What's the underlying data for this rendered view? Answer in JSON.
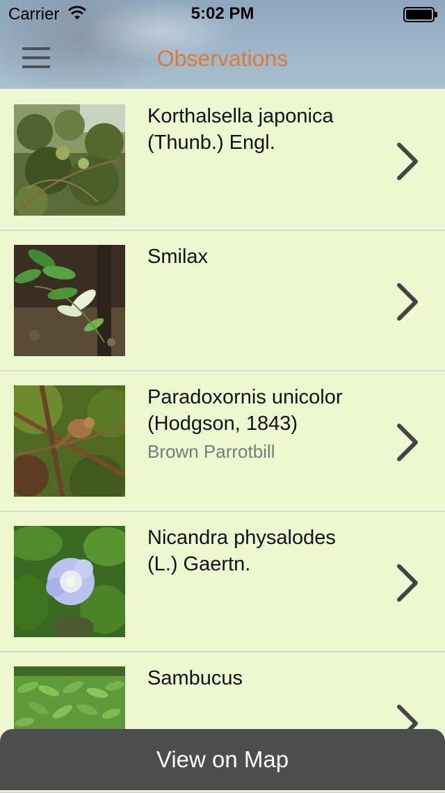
{
  "status_bar": {
    "carrier": "Carrier",
    "time": "5:02 PM"
  },
  "header": {
    "title": "Observations",
    "title_color": "#e07a2c"
  },
  "observations": [
    {
      "scientific_name": "Korthalsella japonica\n(Thunb.) Engl.",
      "common_name": "",
      "thumb": "mistletoe-shrub-photo"
    },
    {
      "scientific_name": "Smilax",
      "common_name": "",
      "thumb": "forest-vine-leaves-photo"
    },
    {
      "scientific_name": "Paradoxornis unicolor\n(Hodgson, 1843)",
      "common_name": "Brown Parrotbill",
      "thumb": "bird-on-branch-photo"
    },
    {
      "scientific_name": "Nicandra physalodes\n(L.) Gaertn.",
      "common_name": "",
      "thumb": "pale-blue-flower-photo"
    },
    {
      "scientific_name": "Sambucus",
      "common_name": "",
      "thumb": "green-compound-leaves-photo"
    }
  ],
  "footer": {
    "map_button_label": "View on Map"
  },
  "colors": {
    "list_background": "#eef8d0",
    "footer_background": "#4e4e4e"
  }
}
